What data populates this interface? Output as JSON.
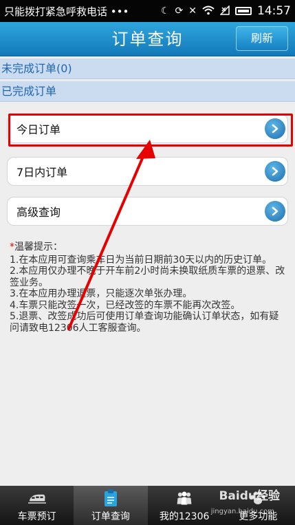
{
  "status_bar": {
    "carrier_text": "只能拨打紧急呼救电话 •••",
    "time": "14:57"
  },
  "header": {
    "title": "订单查询",
    "refresh_label": "刷新"
  },
  "sections": {
    "pending_label": "未完成订单(0)",
    "completed_label": "已完成订单"
  },
  "list": {
    "items": [
      {
        "label": "今日订单"
      },
      {
        "label": "7日内订单"
      },
      {
        "label": "高级查询"
      }
    ]
  },
  "tips": {
    "star": "*",
    "title": "温馨提示：",
    "lines": [
      "1.在本应用可查询乘车日为当前日期前30天以内的历史订单。",
      "2.本应用仅办理不晚于开车前2小时尚未换取纸质车票的退票、改签业务。",
      "3.在本应用办理退票，只能逐次单张办理。",
      "4.车票只能改签一次，已经改签的车票不能再次改签。",
      "5.退票、改签成功后可使用订单查询功能确认订单状态，如有疑问请致电12306人工客服查询。"
    ]
  },
  "tabbar": {
    "tabs": [
      {
        "label": "车票预订",
        "icon": "train-icon"
      },
      {
        "label": "订单查询",
        "icon": "clipboard-icon"
      },
      {
        "label": "我的12306",
        "icon": "people-icon"
      },
      {
        "label": "更多功能",
        "icon": "paw-icon"
      }
    ],
    "active_index": 1
  },
  "watermark": {
    "brand": "Baidu经验",
    "url": "jingyan.baidu.com"
  },
  "colors": {
    "header_blue": "#1c8ccd",
    "section_bg": "#cbdcf0",
    "section_text": "#1d66b5",
    "highlight_red": "#e60000",
    "tabbar_bg": "#1e1e1e"
  }
}
